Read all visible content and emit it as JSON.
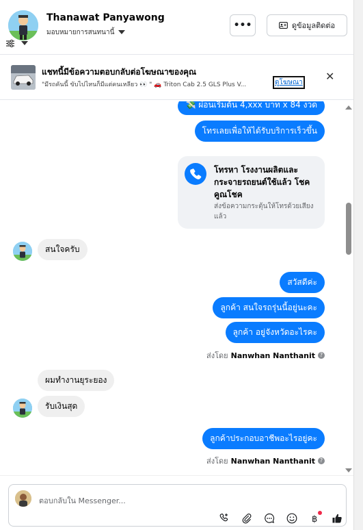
{
  "header": {
    "name": "Thanawat Panyawong",
    "assignment": "มอบหมายการสนทนานี้",
    "more_label": "•••",
    "contact_button": "ดูข้อมูลติดต่อ"
  },
  "ad_banner": {
    "title": "แชทนี้มีข้อความตอบกลับต่อโฆษณาของคุณ",
    "subtitle": "\"มีรถคันนี้ ขับไปไหนก็มีแต่คนเหลียว 👀 \" 🚗 Triton Cab 2.5 GLS Plus V...",
    "link": "ดูโฆษณา",
    "close": "✕"
  },
  "messages": {
    "partial_top": "💸 ผ่อนเริ่มต้น 4,xxx บาท x 84 งวด",
    "m1": "โทรเลยเพื่อให้ได้รับบริการเร็วขึ้น",
    "call_card_title": "โทรหา โรงงานผลิตและกระจายรถยนต์ใช้แล้ว โชคคูณโชค",
    "call_card_sub": "ส่งข้อความกระตุ้นให้โทรด้วยเสียงแล้ว",
    "in1": "สนใจครับ",
    "m2": "สวัสดีค่ะ",
    "m3": "ลูกค้า  สนใจรถรุ่นนี้อยู่นะคะ",
    "m4": "ลูกค้า อยู่จังหวัดอะไรคะ",
    "sent_by_prefix": "ส่งโดย",
    "sent_by_name": "Nanwhan Nanthanit",
    "in2": "ผมทำงานยุระยอง",
    "in3": "รับเงินสุด",
    "m5": "ลูกค้าประกอบอาชีพอะไรอยู่คะ",
    "sent_by_prefix_2": "ส่งโดย",
    "sent_by_name_2": "Nanwhan Nanthanit"
  },
  "composer": {
    "placeholder": "ตอบกลับใน Messenger..."
  },
  "colors": {
    "bubble_out": "#0a7cff",
    "bubble_in": "#efefef",
    "card": "#f0f2f5",
    "notification": "#f02849"
  },
  "icons": [
    "filter-icon",
    "more-icon",
    "contact-card-icon",
    "close-icon",
    "phone-icon",
    "info-icon",
    "call-add-icon",
    "attach-icon",
    "saved-reply-icon",
    "emoji-icon",
    "payment-icon",
    "thumbs-up-icon"
  ]
}
